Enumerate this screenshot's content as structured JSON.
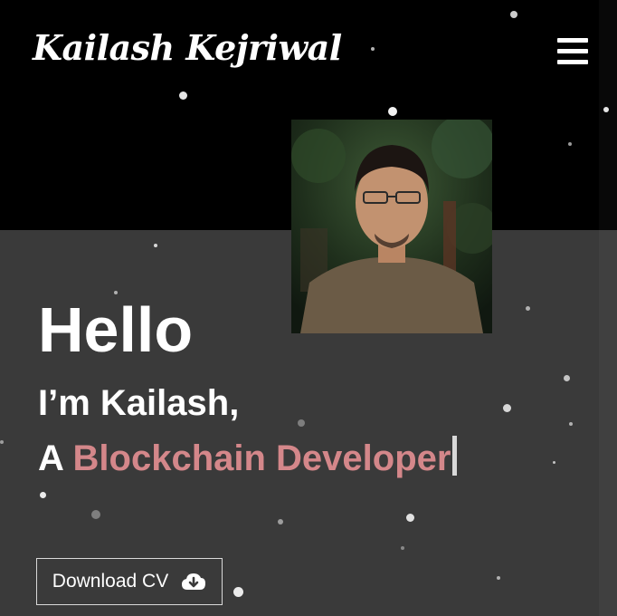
{
  "header": {
    "logo_text": "Kailash Kejriwal",
    "menu_icon": "hamburger-menu-icon"
  },
  "hero": {
    "greeting": "Hello",
    "intro": "I’m Kailash,",
    "role_prefix": "A",
    "role": "Blockchain Developer",
    "cta_label": "Download CV",
    "cta_icon": "cloud-download-icon"
  },
  "colors": {
    "top_background": "#000000",
    "bottom_background": "#3a3a3a",
    "accent": "#d4878a",
    "text": "#ffffff"
  }
}
